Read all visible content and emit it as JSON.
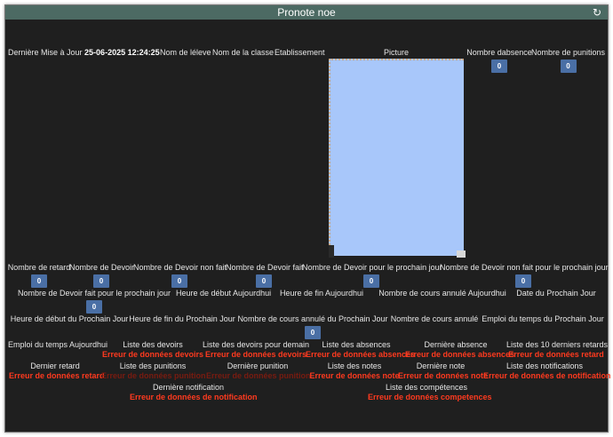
{
  "title": "Pronote noe",
  "refresh_icon": "↻",
  "row1": {
    "last_update_label": "Dernière Mise à Jour",
    "last_update_value": "25-06-2025 12:24:25",
    "student_name": "Nom de léleve",
    "class_name": "Nom de la classe",
    "school": "Etablissement",
    "picture": "Picture",
    "absence_count_label": "Nombre dabsence",
    "absence_count": "0",
    "punition_count_label": "Nombre de punitions",
    "punition_count": "0"
  },
  "row2": {
    "retard_label": "Nombre de retard",
    "retard_value": "0",
    "devoir_label": "Nombre de Devoir",
    "devoir_value": "0",
    "devoir_non_fait_label": "Nombre de Devoir non fait",
    "devoir_non_fait_value": "0",
    "devoir_fait_label": "Nombre de Devoir fait",
    "devoir_fait_value": "0",
    "devoir_prochain_label": "Nombre de Devoir pour le prochain jour",
    "devoir_prochain_value": "0",
    "devoir_non_fait_prochain_label": "Nombre de Devoir non fait pour le prochain jour",
    "devoir_non_fait_prochain_value": "0"
  },
  "row3": {
    "devoir_fait_prochain_label": "Nombre de Devoir fait pour le prochain jour",
    "devoir_fait_prochain_value": "0",
    "heure_debut_aujourdhui": "Heure de début Aujourdhui",
    "heure_fin_aujourdhui": "Heure de fin Aujourdhui",
    "cours_annule_aujourdhui": "Nombre de cours annulé Aujourdhui",
    "date_prochain_jour": "Date du Prochain Jour"
  },
  "row4": {
    "heure_debut_prochain": "Heure de début du Prochain Jour",
    "heure_fin_prochain": "Heure de fin du Prochain Jour",
    "cours_annule_prochain_label": "Nombre de cours annulé du Prochain Jour",
    "cours_annule_prochain_value": "0",
    "cours_annule_label": "Nombre de cours annulé",
    "emploi_prochain": "Emploi du temps du Prochain Jour"
  },
  "row5": {
    "emploi_aujourdhui": "Emploi du temps Aujourdhui",
    "liste_devoirs": "Liste des devoirs",
    "liste_devoirs_err": "Erreur de données devoirs",
    "liste_devoirs_demain": "Liste des devoirs pour demain",
    "liste_devoirs_demain_err": "Erreur de données devoirs",
    "liste_absences": "Liste des absences",
    "liste_absences_err": "Erreur de données absences",
    "derniere_absence": "Dernière absence",
    "derniere_absence_err": "Erreur de données absences",
    "derniers_retards": "Liste des 10 derniers retards",
    "derniers_retards_err": "Erreur de données retard"
  },
  "row6": {
    "dernier_retard": "Dernier retard",
    "dernier_retard_err": "Erreur de données retard",
    "liste_punitions": "Liste des punitions",
    "liste_punitions_err": "Erreur de données punition",
    "derniere_punition": "Dernière punition",
    "derniere_punition_err": "Erreur de données punition",
    "liste_notes": "Liste des notes",
    "liste_notes_err": "Erreur de données note",
    "derniere_note": "Dernière note",
    "derniere_note_err": "Erreur de données note",
    "liste_notifications": "Liste des notifications",
    "liste_notifications_err": "Erreur de données de notification"
  },
  "row7": {
    "derniere_notification": "Dernière notification",
    "derniere_notification_err": "Erreur de données de notification",
    "liste_competences": "Liste des compétences",
    "liste_competences_err": "Erreur de données competences"
  }
}
